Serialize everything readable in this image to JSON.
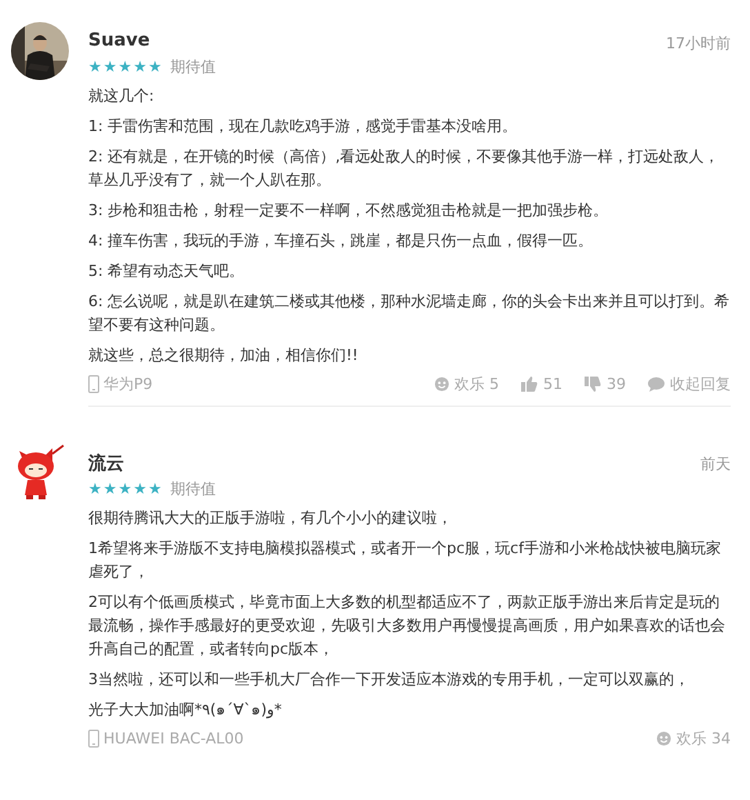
{
  "reviews": [
    {
      "avatar": {
        "kind": "picture"
      },
      "name": "Suave",
      "time": "17小时前",
      "stars": 5,
      "rating_label": "期待值",
      "paragraphs": [
        "就这几个:",
        "1: 手雷伤害和范围，现在几款吃鸡手游，感觉手雷基本没啥用。",
        "2: 还有就是，在开镜的时候（高倍）,看远处敌人的时候，不要像其他手游一样，打远处敌人，草丛几乎没有了，就一个人趴在那。",
        "3: 步枪和狙击枪，射程一定要不一样啊，不然感觉狙击枪就是一把加强步枪。",
        "4: 撞车伤害，我玩的手游，车撞石头，跳崖，都是只伤一点血，假得一匹。",
        "5: 希望有动态天气吧。",
        "6: 怎么说呢，就是趴在建筑二楼或其他楼，那种水泥墙走廊，你的头会卡出来并且可以打到。希望不要有这种问题。",
        "就这些，总之很期待，加油，相信你们!!"
      ],
      "device": "华为P9",
      "actions": [
        {
          "kind": "fun",
          "label": "欢乐 5"
        },
        {
          "kind": "like",
          "label": "51"
        },
        {
          "kind": "dislike",
          "label": "39"
        },
        {
          "kind": "reply",
          "label": "收起回复"
        }
      ]
    },
    {
      "avatar": {
        "kind": "cartoon"
      },
      "name": "流云",
      "time": "前天",
      "stars": 5,
      "rating_label": "期待值",
      "paragraphs": [
        "很期待腾讯大大的正版手游啦，有几个小小的建议啦，",
        "1希望将来手游版不支持电脑模拟器模式，或者开一个pc服，玩cf手游和小米枪战快被电脑玩家虐死了，",
        "2可以有个低画质模式，毕竟市面上大多数的机型都适应不了，两款正版手游出来后肯定是玩的最流畅，操作手感最好的更受欢迎，先吸引大多数用户再慢慢提高画质，用户如果喜欢的话也会升高自己的配置，或者转向pc版本，",
        "3当然啦，还可以和一些手机大厂合作一下开发适应本游戏的专用手机，一定可以双赢的，",
        "光子大大加油啊*٩(๑´∀`๑)و*"
      ],
      "device": "HUAWEI BAC-AL00",
      "actions": [
        {
          "kind": "fun",
          "label": "欢乐 34"
        }
      ]
    }
  ]
}
